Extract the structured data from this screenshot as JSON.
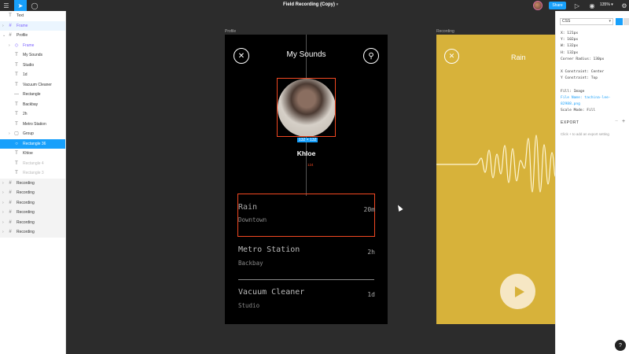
{
  "toolbar": {
    "menu_icon": "hamburger-icon",
    "move_icon": "cursor-icon",
    "comment_icon": "comment-icon",
    "doc_title": "Field Recording (Copy)",
    "doc_chevron": "▾",
    "share_label": "Share",
    "zoom": "135%",
    "zoom_chevron": "▾"
  },
  "layers": [
    {
      "label": "Text",
      "icon": "T",
      "indent": 1,
      "state": ""
    },
    {
      "label": "Frame",
      "icon": "#",
      "indent": 1,
      "state": "purple hl",
      "caret": "›"
    },
    {
      "label": "Profile",
      "icon": "#",
      "indent": 1,
      "state": "",
      "caret": "⌄"
    },
    {
      "label": "Frame",
      "icon": "◇",
      "indent": 2,
      "state": "purple",
      "caret": "›"
    },
    {
      "label": "My Sounds",
      "icon": "T",
      "indent": 2,
      "state": ""
    },
    {
      "label": "Studio",
      "icon": "T",
      "indent": 2,
      "state": ""
    },
    {
      "label": "1d",
      "icon": "T",
      "indent": 2,
      "state": ""
    },
    {
      "label": "Vacuum Cleaner",
      "icon": "T",
      "indent": 2,
      "state": ""
    },
    {
      "label": "Rectangle",
      "icon": "—",
      "indent": 2,
      "state": ""
    },
    {
      "label": "Backbay",
      "icon": "T",
      "indent": 2,
      "state": ""
    },
    {
      "label": "2h",
      "icon": "T",
      "indent": 2,
      "state": ""
    },
    {
      "label": "Metro Station",
      "icon": "T",
      "indent": 2,
      "state": ""
    },
    {
      "label": "Group",
      "icon": "▢",
      "indent": 2,
      "state": "",
      "caret": "›"
    },
    {
      "label": "Rectangle 36",
      "icon": "○",
      "indent": 2,
      "state": "sel"
    },
    {
      "label": "Khloe",
      "icon": "T",
      "indent": 2,
      "state": ""
    },
    {
      "label": "Rectangle 4",
      "icon": "T",
      "indent": 2,
      "state": "dim"
    },
    {
      "label": "Rectangle 3",
      "icon": "T",
      "indent": 2,
      "state": "dim"
    },
    {
      "label": "Recording",
      "icon": "#",
      "indent": 1,
      "state": "grey",
      "caret": "›"
    },
    {
      "label": "Recording",
      "icon": "#",
      "indent": 1,
      "state": "grey",
      "caret": "›"
    },
    {
      "label": "Recording",
      "icon": "#",
      "indent": 1,
      "state": "grey",
      "caret": "›"
    },
    {
      "label": "Recording",
      "icon": "#",
      "indent": 1,
      "state": "grey",
      "caret": "›"
    },
    {
      "label": "Recording",
      "icon": "#",
      "indent": 1,
      "state": "grey",
      "caret": "›"
    },
    {
      "label": "Recording",
      "icon": "#",
      "indent": 1,
      "state": "grey",
      "caret": "›"
    }
  ],
  "canvas": {
    "profile_label": "Profile",
    "recording_label": "Recording",
    "profile": {
      "title": "My Sounds",
      "close_icon": "✕",
      "pin_icon": "⚲",
      "dims": "132 × 132",
      "name": "Khloe",
      "measure": "124",
      "rows": [
        {
          "title": "Rain",
          "sub": "Downtown",
          "time": "20m"
        },
        {
          "title": "Metro Station",
          "sub": "Backbay",
          "time": "2h"
        },
        {
          "title": "Vacuum Cleaner",
          "sub": "Studio",
          "time": "1d"
        }
      ]
    },
    "recording": {
      "close_icon": "✕",
      "title": "Rain"
    }
  },
  "properties": {
    "mode": "CSS",
    "mode_chevron": "▾",
    "code": [
      "X: 121px",
      "Y: 102px",
      "W: 132px",
      "H: 132px",
      "Corner Radius: 130px",
      "",
      "X Constraint: Center",
      "Y Constraint: Top",
      "",
      "Fill: Image",
      "File Name: tachina-lee-",
      "   82988.png",
      "Scale Mode: Fill"
    ],
    "export_title": "EXPORT",
    "export_minus": "−",
    "export_plus": "+",
    "export_hint": "Click + to add an export setting",
    "help": "?"
  }
}
